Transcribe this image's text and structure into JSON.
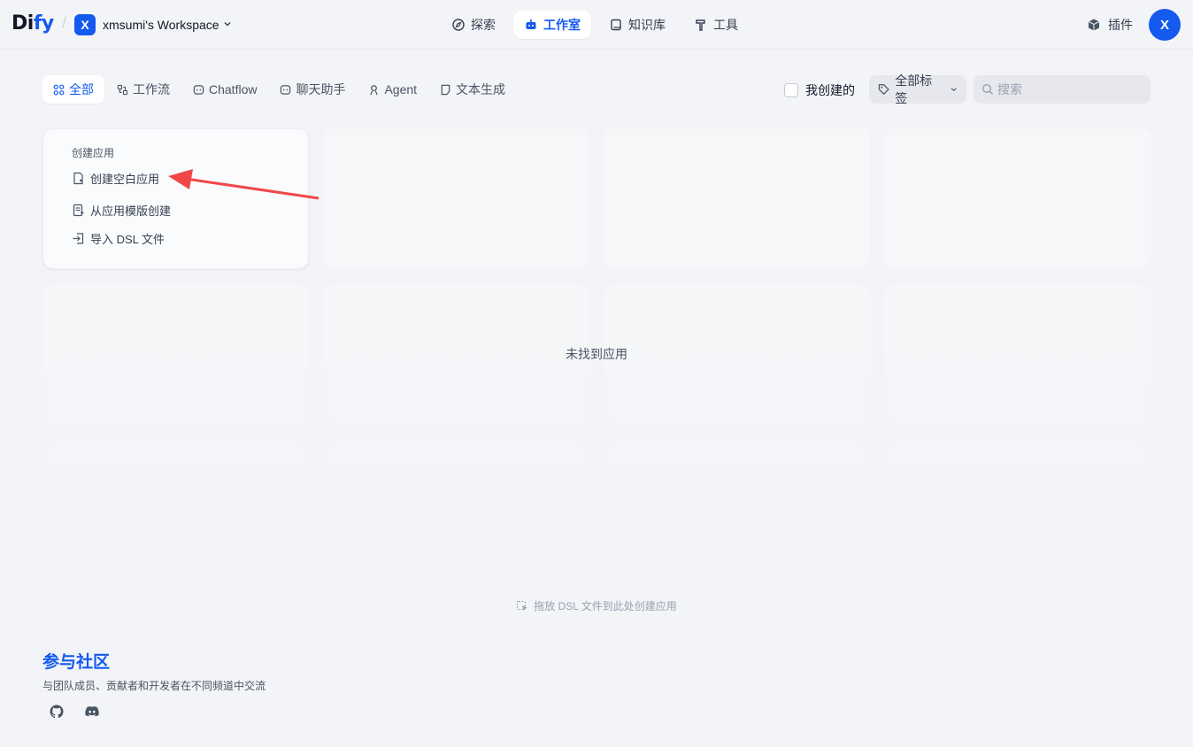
{
  "header": {
    "logo_main": "Di",
    "logo_accent": "fy",
    "workspace_initial": "X",
    "workspace_name": "xmsumi's Workspace",
    "nav": [
      {
        "label": "探索",
        "icon": "compass-icon"
      },
      {
        "label": "工作室",
        "icon": "robot-icon",
        "active": true
      },
      {
        "label": "知识库",
        "icon": "book-icon"
      },
      {
        "label": "工具",
        "icon": "hammer-icon"
      }
    ],
    "plugin_label": "插件",
    "avatar_initial": "X"
  },
  "filters": {
    "tabs": [
      {
        "label": "全部",
        "icon": "grid-icon",
        "active": true
      },
      {
        "label": "工作流",
        "icon": "workflow-icon"
      },
      {
        "label": "Chatflow",
        "icon": "chatflow-icon"
      },
      {
        "label": "聊天助手",
        "icon": "chat-icon"
      },
      {
        "label": "Agent",
        "icon": "agent-icon"
      },
      {
        "label": "文本生成",
        "icon": "document-icon"
      }
    ],
    "mine_label": "我创建的",
    "tags_label": "全部标签",
    "search_placeholder": "搜索"
  },
  "create_card": {
    "title": "创建应用",
    "items": [
      {
        "label": "创建空白应用",
        "icon": "file-plus-icon"
      },
      {
        "label": "从应用模版创建",
        "icon": "template-icon"
      },
      {
        "label": "导入 DSL 文件",
        "icon": "import-icon"
      }
    ]
  },
  "empty_text": "未找到应用",
  "drop_hint": "拖放 DSL 文件到此处创建应用",
  "community": {
    "title": "参与社区",
    "description": "与团队成员、贡献者和开发者在不同频道中交流",
    "links": [
      "github-icon",
      "discord-icon"
    ]
  },
  "colors": {
    "accent": "#155aef",
    "background": "#f2f4f7",
    "annotation_arrow": "#f04848"
  }
}
